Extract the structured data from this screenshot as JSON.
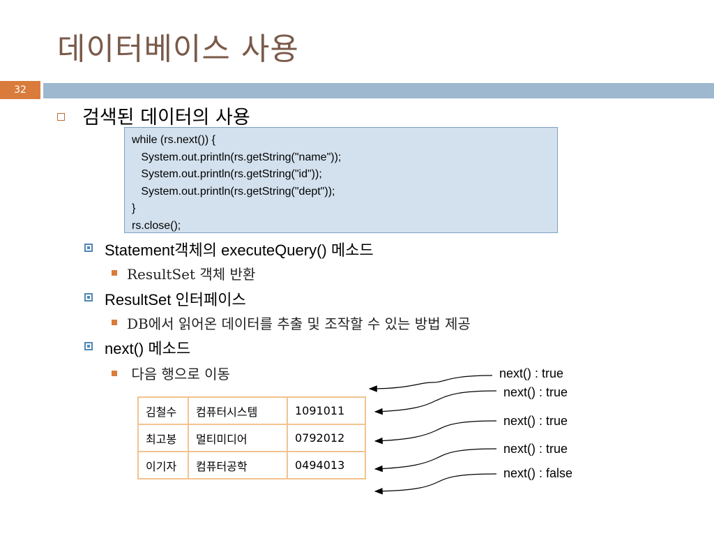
{
  "slide": {
    "title": "데이터베이스 사용",
    "page_number": "32",
    "heading": "검색된 데이터의 사용",
    "code_lines": [
      "while (rs.next()) {",
      "   System.out.println(rs.getString(\"name\"));",
      "   System.out.println(rs.getString(\"id\"));",
      "   System.out.println(rs.getString(\"dept\"));",
      "}",
      "rs.close();"
    ],
    "bullets": [
      {
        "text": "Statement객체의 executeQuery() 메소드",
        "sub": "ResultSet 객체 반환"
      },
      {
        "text": "ResultSet 인터페이스",
        "sub": "DB에서 읽어온 데이터를 추출 및 조작할 수 있는 방법 제공"
      },
      {
        "text": "next() 메소드",
        "sub": " 다음 행으로 이동"
      }
    ],
    "table_rows": [
      [
        "김철수",
        "컴퓨터시스템",
        "1091011"
      ],
      [
        "최고봉",
        "멀티미디어",
        "0792012"
      ],
      [
        "이기자",
        "컴퓨터공학",
        "0494013"
      ]
    ],
    "next_labels": [
      "next() : true",
      "next() : true",
      "next() : true",
      "next() : true",
      "next() : false"
    ]
  },
  "colors": {
    "title": "#7a5a4a",
    "band": "#9db8cf",
    "page_box": "#d97c3b",
    "code_bg": "#d3e1ee",
    "code_border": "#7d9fc6",
    "table_border": "#f2c38f"
  }
}
